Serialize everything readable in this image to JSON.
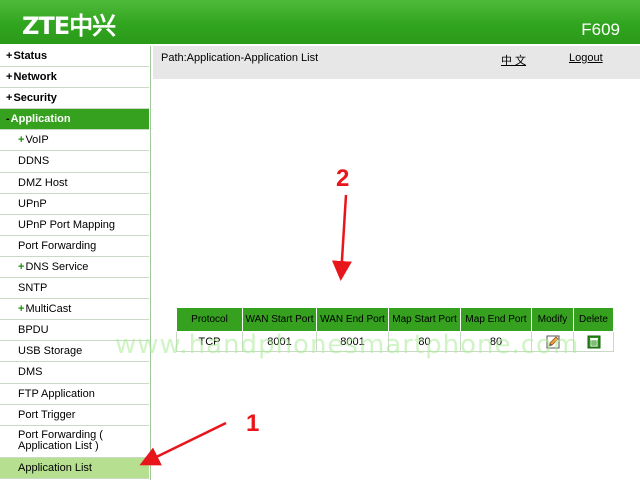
{
  "header": {
    "logo": "ZTE中兴",
    "model": "F609"
  },
  "sidebar": {
    "items": [
      {
        "label": "Status",
        "level": "top",
        "prefix": "+"
      },
      {
        "label": "Network",
        "level": "top",
        "prefix": "+"
      },
      {
        "label": "Security",
        "level": "top",
        "prefix": "+"
      },
      {
        "label": "Application",
        "level": "top",
        "prefix": "-",
        "active": true
      },
      {
        "label": "VoIP",
        "level": "sub",
        "prefix": "+"
      },
      {
        "label": "DDNS",
        "level": "item"
      },
      {
        "label": "DMZ Host",
        "level": "item"
      },
      {
        "label": "UPnP",
        "level": "item"
      },
      {
        "label": "UPnP Port Mapping",
        "level": "item"
      },
      {
        "label": "Port Forwarding",
        "level": "item"
      },
      {
        "label": "DNS Service",
        "level": "sub",
        "prefix": "+"
      },
      {
        "label": "SNTP",
        "level": "item"
      },
      {
        "label": "MultiCast",
        "level": "sub",
        "prefix": "+"
      },
      {
        "label": "BPDU",
        "level": "item"
      },
      {
        "label": "USB Storage",
        "level": "item"
      },
      {
        "label": "DMS",
        "level": "item"
      },
      {
        "label": "FTP Application",
        "level": "item"
      },
      {
        "label": "Port Trigger",
        "level": "item"
      },
      {
        "label": "Port Forwarding ( Application List )",
        "level": "item",
        "two_line": true
      },
      {
        "label": "Application List",
        "level": "item",
        "selected": true
      }
    ]
  },
  "pathbar": {
    "path": "Path:Application-Application List",
    "language": "中 文",
    "logout": "Logout"
  },
  "table": {
    "headers": [
      "Protocol",
      "WAN Start Port",
      "WAN End Port",
      "Map Start Port",
      "Map End Port",
      "Modify",
      "Delete"
    ],
    "rows": [
      {
        "protocol": "TCP",
        "wan_start": "8001",
        "wan_end": "8001",
        "map_start": "80",
        "map_end": "80"
      }
    ]
  },
  "watermark": "www.handphonesmartphone.com",
  "annotations": [
    {
      "label": "1"
    },
    {
      "label": "2"
    }
  ],
  "colors": {
    "header_green": "#31a51f",
    "nav_active": "#35a11f",
    "nav_selected": "#b6df8f",
    "annotation_red": "#e8151b"
  }
}
